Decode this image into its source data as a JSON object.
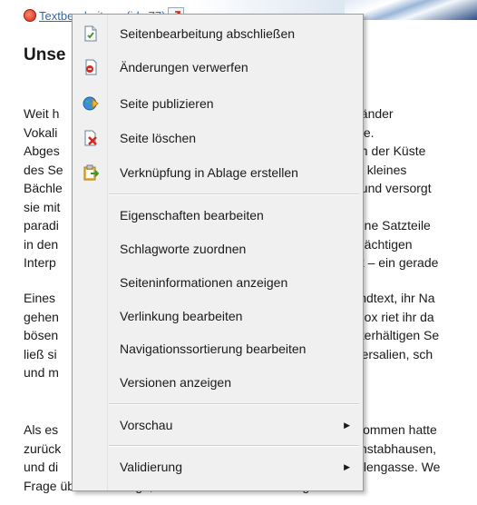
{
  "top": {
    "edit_link": "Textbearbeitung (ids 77)"
  },
  "page": {
    "title": "Unse",
    "paragraphs": [
      {
        "lines": [
          {
            "left": "Weit h",
            "right": "Länder"
          },
          {
            "left": "Vokali",
            "right": "kte."
          },
          {
            "left": "Abges",
            "right": "an der Küste"
          },
          {
            "left": "des Se",
            "right": "in kleines"
          },
          {
            "left": "Bächle",
            "right": "t und versorgt"
          },
          {
            "left": "sie mit",
            "right": ""
          },
          {
            "left": "paradi",
            "right": "tene Satzteile"
          },
          {
            "left": "in den",
            "right": "mächtigen"
          },
          {
            "left": "Interp",
            "right": "ht – ein gerade"
          }
        ]
      },
      {
        "lines": [
          {
            "left": "Eines",
            "right": "lindtext, ihr Na"
          },
          {
            "left": "gehen",
            "right": "mox riet ihr da"
          },
          {
            "left": "bösen",
            "right": "nterhältigen Se"
          },
          {
            "left": "ließ si",
            "right": "Versalien, sch"
          },
          {
            "left": "und m",
            "right": ""
          }
        ]
      },
      {
        "lines": [
          {
            "left": "Als es",
            "right": "klommen hatte"
          },
          {
            "left": "zurück",
            "right": "chstabhausen,"
          },
          {
            "left": "und di",
            "right": "eilengasse. We"
          },
          {
            "left": "Frage über die Wange, dann setzte es seinen Weg fort.",
            "right": ""
          }
        ]
      }
    ]
  },
  "menu": {
    "items": [
      {
        "label": "Seitenbearbeitung abschließen",
        "icon": "page-done-icon"
      },
      {
        "label": "Änderungen verwerfen",
        "icon": "discard-changes-icon"
      },
      {
        "label": "Seite publizieren",
        "icon": "publish-globe-icon"
      },
      {
        "label": "Seite löschen",
        "icon": "delete-page-icon"
      },
      {
        "label": "Verknüpfung in Ablage erstellen",
        "icon": "clipboard-link-icon"
      },
      {
        "label": "Eigenschaften bearbeiten"
      },
      {
        "label": "Schlagworte zuordnen"
      },
      {
        "label": "Seiteninformationen anzeigen"
      },
      {
        "label": "Verlinkung bearbeiten"
      },
      {
        "label": "Navigationssortierung bearbeiten"
      },
      {
        "label": "Versionen anzeigen"
      },
      {
        "label": "Vorschau",
        "submenu": true
      },
      {
        "label": "Validierung",
        "submenu": true
      }
    ],
    "submenu_arrow": "▶",
    "colors": {
      "background": "#f0f0f0",
      "border": "#9b9b9b",
      "accent_link": "#2f6aa8"
    }
  }
}
